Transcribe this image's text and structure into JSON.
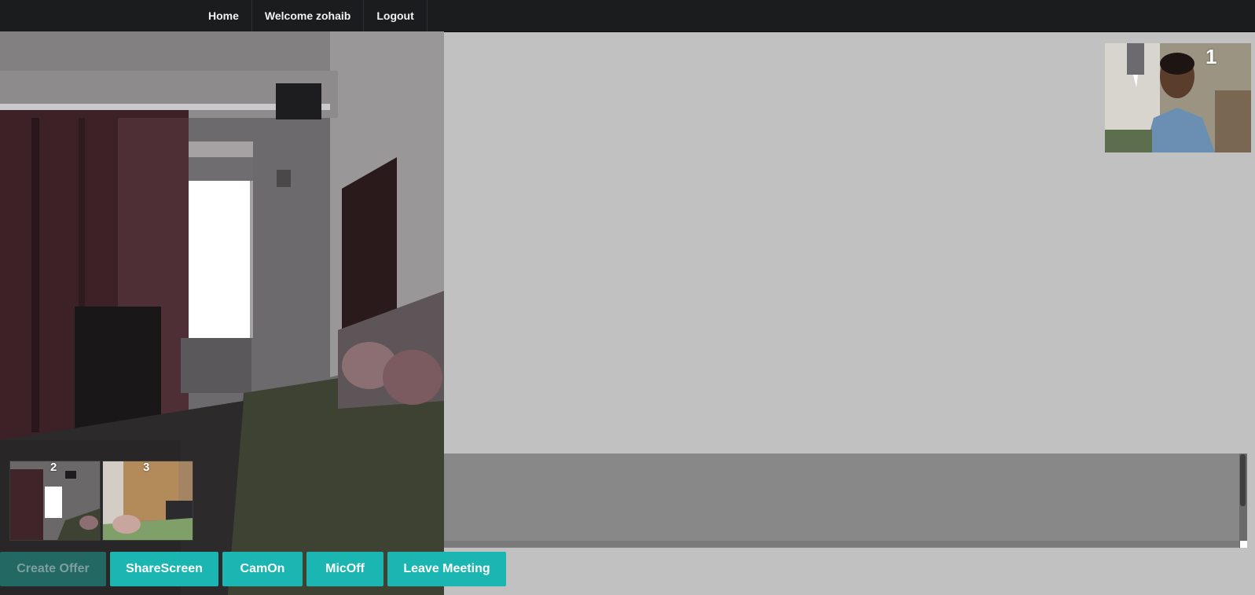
{
  "nav": {
    "items": [
      {
        "label": "Home"
      },
      {
        "label": "Welcome zohaib"
      },
      {
        "label": "Logout"
      }
    ]
  },
  "remote": {
    "number": "1"
  },
  "thumbnails": [
    {
      "number": "2"
    },
    {
      "number": "3"
    }
  ],
  "controls": {
    "create_offer": "Create Offer",
    "share_screen": "ShareScreen",
    "cam": "CamOn",
    "mic": "MicOff",
    "leave": "Leave Meeting"
  },
  "colors": {
    "navbar": "#1b1c1e",
    "background": "#c1c1c1",
    "button": "#1bb5b2",
    "button_disabled": "#246864",
    "panel": "#888888"
  }
}
